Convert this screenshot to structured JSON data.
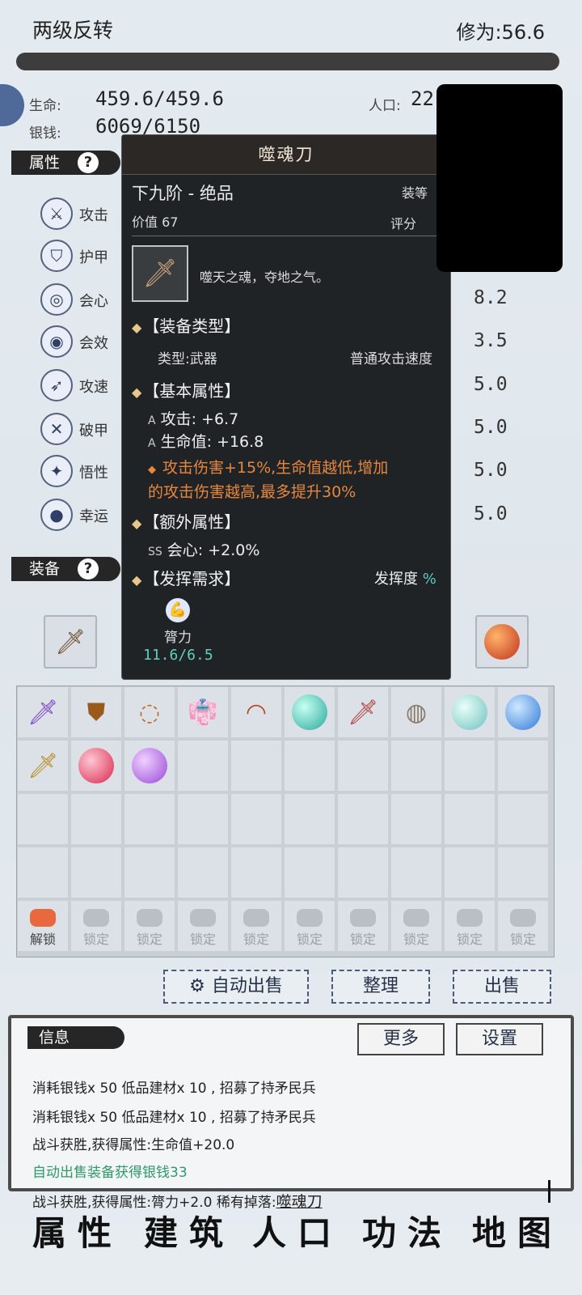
{
  "header": {
    "title": "两级反转",
    "cultivation": "修为:56.6"
  },
  "stats_top": {
    "hp_label": "生命:",
    "hp_value": "459.6/459.6",
    "silver_label": "银钱:",
    "silver_value": "6069/6150",
    "pop_label": "人口:",
    "pop_value": "22"
  },
  "sections": {
    "attr": "属性",
    "equip": "装备",
    "help": "?"
  },
  "attributes": [
    {
      "name": "攻击",
      "icon": "sword-icon"
    },
    {
      "name": "护甲",
      "icon": "shield-icon"
    },
    {
      "name": "会心",
      "icon": "target-icon"
    },
    {
      "name": "会效",
      "icon": "bullseye-icon"
    },
    {
      "name": "攻速",
      "icon": "speed-icon"
    },
    {
      "name": "破甲",
      "icon": "break-armor-icon"
    },
    {
      "name": "悟性",
      "icon": "sparkle-icon"
    },
    {
      "name": "幸运",
      "icon": "luck-icon"
    }
  ],
  "right_values": [
    "8.2",
    "3.5",
    "5.0",
    "5.0",
    "5.0",
    "5.0"
  ],
  "tooltip": {
    "name": "噬魂刀",
    "tier": "下九阶 - 绝品",
    "level_label": "装等",
    "value_label": "价值",
    "value": "67",
    "score_label": "评分",
    "desc": "噬天之魂，夺地之气。",
    "type_header": "【装备类型】",
    "type_text": "类型:武器",
    "type_extra": "普通攻击速度",
    "base_header": "【基本属性】",
    "base_attr1_grade": "A",
    "base_attr1": "攻击: +6.7",
    "base_attr2_grade": "A",
    "base_attr2": "生命值: +16.8",
    "special_line1": "攻击伤害+15%,生命值越低,增加",
    "special_line2": "的攻击伤害越高,最多提升30%",
    "extra_header": "【额外属性】",
    "extra_grade": "SS",
    "extra_attr": "会心: +2.0%",
    "req_header": "【发挥需求】",
    "req_ratio_label": "发挥度",
    "req_ratio_unit": "%",
    "req_name": "膂力",
    "req_value": "11.6/6.5"
  },
  "inventory": {
    "items": [
      "purple-sword",
      "gold-seal",
      "prayer-beads",
      "robe",
      "fan",
      "cyan-orb",
      "red-sword",
      "mirror",
      "crystal-ball",
      "blue-orb",
      "golden-sword",
      "red-orb",
      "purple-orb"
    ],
    "unlock_label": "解锁",
    "lock_label": "锁定"
  },
  "buttons": {
    "auto_sell": "自动出售",
    "sort": "整理",
    "sell": "出售",
    "more": "更多",
    "settings": "设置"
  },
  "info": {
    "title": "信息",
    "logs": [
      "消耗银钱x 50 低品建材x 10 , 招募了持矛民兵",
      "消耗银钱x 50 低品建材x 10 , 招募了持矛民兵",
      "战斗获胜,获得属性:生命值+20.0",
      "自动出售装备获得银钱33",
      "战斗获胜,获得属性:膂力+2.0"
    ],
    "rare_label": "稀有掉落:",
    "rare_item": "噬魂刀"
  },
  "nav": [
    "属性",
    "建筑",
    "人口",
    "功法",
    "地图"
  ],
  "colors": {
    "accent": "#e7873d",
    "green": "#2e9a6a",
    "dark": "#262626"
  }
}
